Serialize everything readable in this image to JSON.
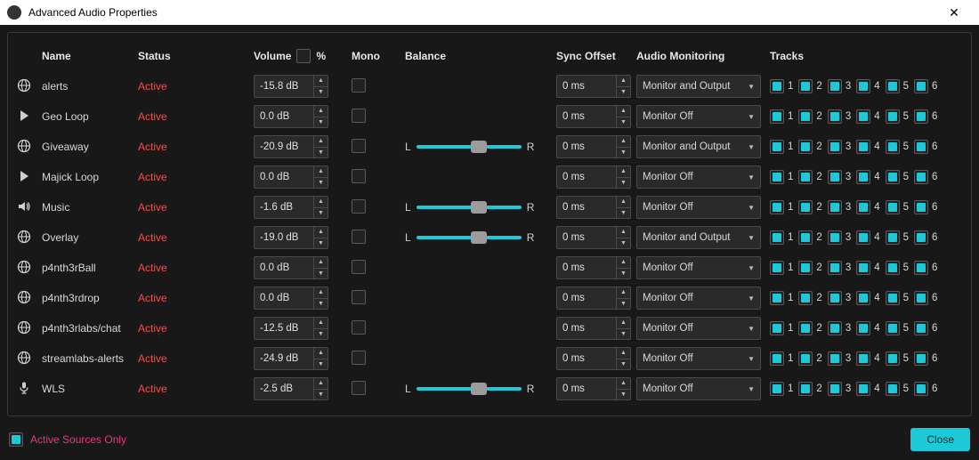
{
  "window": {
    "title": "Advanced Audio Properties"
  },
  "headers": {
    "name": "Name",
    "status": "Status",
    "volume": "Volume",
    "percent": "%",
    "mono": "Mono",
    "balance": "Balance",
    "sync": "Sync Offset",
    "monitoring": "Audio Monitoring",
    "tracks": "Tracks"
  },
  "balance_labels": {
    "left": "L",
    "right": "R"
  },
  "track_numbers": [
    "1",
    "2",
    "3",
    "4",
    "5",
    "6"
  ],
  "rows": [
    {
      "icon": "globe",
      "name": "alerts",
      "status": "Active",
      "volume": "-15.8 dB",
      "mono": false,
      "balance": null,
      "sync": "0 ms",
      "monitoring": "Monitor and Output",
      "tracks": [
        true,
        true,
        true,
        true,
        true,
        true
      ]
    },
    {
      "icon": "play",
      "name": "Geo Loop",
      "status": "Active",
      "volume": "0.0 dB",
      "mono": false,
      "balance": null,
      "sync": "0 ms",
      "monitoring": "Monitor Off",
      "tracks": [
        true,
        true,
        true,
        true,
        true,
        true
      ]
    },
    {
      "icon": "globe",
      "name": "Giveaway",
      "status": "Active",
      "volume": "-20.9 dB",
      "mono": false,
      "balance": 60,
      "sync": "0 ms",
      "monitoring": "Monitor and Output",
      "tracks": [
        true,
        true,
        true,
        true,
        true,
        true
      ]
    },
    {
      "icon": "play",
      "name": "Majick Loop",
      "status": "Active",
      "volume": "0.0 dB",
      "mono": false,
      "balance": null,
      "sync": "0 ms",
      "monitoring": "Monitor Off",
      "tracks": [
        true,
        true,
        true,
        true,
        true,
        true
      ]
    },
    {
      "icon": "speaker",
      "name": "Music",
      "status": "Active",
      "volume": "-1.6 dB",
      "mono": false,
      "balance": 60,
      "sync": "0 ms",
      "monitoring": "Monitor Off",
      "tracks": [
        true,
        true,
        true,
        true,
        true,
        true
      ]
    },
    {
      "icon": "globe",
      "name": "Overlay",
      "status": "Active",
      "volume": "-19.0 dB",
      "mono": false,
      "balance": 60,
      "sync": "0 ms",
      "monitoring": "Monitor and Output",
      "tracks": [
        true,
        true,
        true,
        true,
        true,
        true
      ]
    },
    {
      "icon": "globe",
      "name": "p4nth3rBall",
      "status": "Active",
      "volume": "0.0 dB",
      "mono": false,
      "balance": null,
      "sync": "0 ms",
      "monitoring": "Monitor Off",
      "tracks": [
        true,
        true,
        true,
        true,
        true,
        true
      ]
    },
    {
      "icon": "globe",
      "name": "p4nth3rdrop",
      "status": "Active",
      "volume": "0.0 dB",
      "mono": false,
      "balance": null,
      "sync": "0 ms",
      "monitoring": "Monitor Off",
      "tracks": [
        true,
        true,
        true,
        true,
        true,
        true
      ]
    },
    {
      "icon": "globe",
      "name": "p4nth3rlabs/chat",
      "status": "Active",
      "volume": "-12.5 dB",
      "mono": false,
      "balance": null,
      "sync": "0 ms",
      "monitoring": "Monitor Off",
      "tracks": [
        true,
        true,
        true,
        true,
        true,
        true
      ]
    },
    {
      "icon": "globe",
      "name": "streamlabs-alerts",
      "status": "Active",
      "volume": "-24.9 dB",
      "mono": false,
      "balance": null,
      "sync": "0 ms",
      "monitoring": "Monitor Off",
      "tracks": [
        true,
        true,
        true,
        true,
        true,
        true
      ]
    },
    {
      "icon": "mic",
      "name": "WLS",
      "status": "Active",
      "volume": "-2.5 dB",
      "mono": false,
      "balance": 60,
      "sync": "0 ms",
      "monitoring": "Monitor Off",
      "tracks": [
        true,
        true,
        true,
        true,
        true,
        true
      ]
    }
  ],
  "footer": {
    "active_only_label": "Active Sources Only",
    "active_only_checked": true,
    "close_label": "Close"
  }
}
